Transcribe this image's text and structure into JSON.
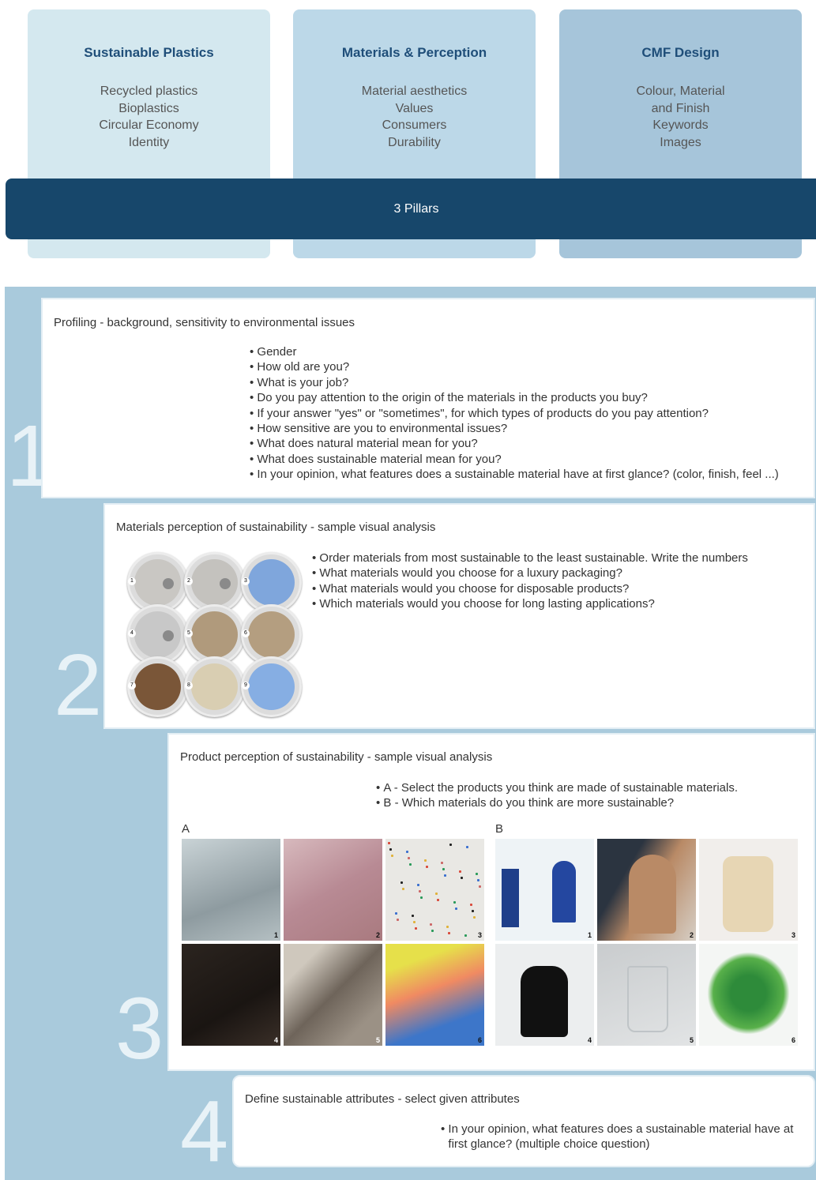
{
  "pillars": [
    {
      "title": "Sustainable Plastics",
      "items": [
        "Recycled plastics",
        "Bioplastics",
        "Circular Economy",
        "Identity"
      ]
    },
    {
      "title": "Materials & Perception",
      "items": [
        "Material aesthetics",
        "Values",
        "Consumers",
        "Durability"
      ]
    },
    {
      "title": "CMF Design",
      "items": [
        "Colour, Material",
        "and Finish",
        "Keywords",
        "Images"
      ]
    }
  ],
  "bar_label": "3 Pillars",
  "steps": [
    {
      "number": "1",
      "title": "Profiling - background, sensitivity to environmental issues",
      "bullets": [
        "Gender",
        "How old are you?",
        "What is your job?",
        "Do you pay attention to the origin of the materials in the products you buy?",
        "If your answer \"yes\" or \"sometimes\", for which types of products do you pay attention?",
        "How sensitive are you to environmental issues?",
        "What does natural material mean for you?",
        "What does sustainable material mean for you?",
        "In your opinion, what features does a sustainable material have at first glance? (color, finish, feel ...)"
      ]
    },
    {
      "number": "2",
      "title": "Materials perception of sustainability - sample visual analysis",
      "bullets": [
        "Order materials from most sustainable to the least sustainable. Write the numbers",
        "What materials would you choose for a luxury packaging?",
        "What materials would you choose for disposable products?",
        "Which materials would you choose for long lasting applications?"
      ],
      "samples": [
        {
          "n": "1",
          "color": "#c9c7c3"
        },
        {
          "n": "2",
          "color": "#c4c2be"
        },
        {
          "n": "3",
          "color": "#7fa6dc"
        },
        {
          "n": "4",
          "color": "#c8c8c8"
        },
        {
          "n": "5",
          "color": "#b09a7c"
        },
        {
          "n": "6",
          "color": "#b49e80"
        },
        {
          "n": "7",
          "color": "#7a5638"
        },
        {
          "n": "8",
          "color": "#d9ceb2"
        },
        {
          "n": "9",
          "color": "#86aee3"
        }
      ]
    },
    {
      "number": "3",
      "title": "Product perception of sustainability - sample visual analysis",
      "bullets": [
        "A - Select the products you think are made of sustainable materials.",
        "B - Which materials do you think are more sustainable?"
      ],
      "group_a_label": "A",
      "group_b_label": "B",
      "group_a": [
        {
          "n": "1",
          "bg": "linear-gradient(160deg,#c9d3d6,#8e9ba0 60%,#b5c0c3)"
        },
        {
          "n": "2",
          "bg": "linear-gradient(150deg,#d7b9bd,#b88a94 50%,#a97a7f)"
        },
        {
          "n": "3",
          "bg": "#e9e8e4"
        },
        {
          "n": "4",
          "bg": "linear-gradient(150deg,#2b241f,#1a1512 60%,#3a2f28)"
        },
        {
          "n": "5",
          "bg": "linear-gradient(135deg,#cfc8bd 20%,#6e645a 50%,#9b9185 80%)"
        },
        {
          "n": "6",
          "bg": "linear-gradient(160deg,#e6e04a 20%,#f08a62 45%,#3d76c9 75%)"
        }
      ],
      "group_b": [
        {
          "n": "1",
          "bg": "#eef3f6"
        },
        {
          "n": "2",
          "bg": "linear-gradient(120deg,#2b3440 30%,#b98a66 55%,#d6cfc6)"
        },
        {
          "n": "3",
          "bg": "#f1eeeb"
        },
        {
          "n": "4",
          "bg": "#eceeef"
        },
        {
          "n": "5",
          "bg": "linear-gradient(160deg,#c9ccce,#e2e4e5)"
        },
        {
          "n": "6",
          "bg": "#f4f6f4"
        }
      ]
    },
    {
      "number": "4",
      "title": "Define sustainable attributes - select given attributes",
      "bullets": [
        "In your opinion, what features does a sustainable material have at first glance? (multiple choice question)"
      ]
    }
  ],
  "colors": {
    "pillar1": "#d4e8ef",
    "pillar2": "#bcd8e8",
    "pillar3": "#a6c5da",
    "bar": "#17476b",
    "title_text": "#1f4e79",
    "background_panel": "#a9cadc"
  }
}
